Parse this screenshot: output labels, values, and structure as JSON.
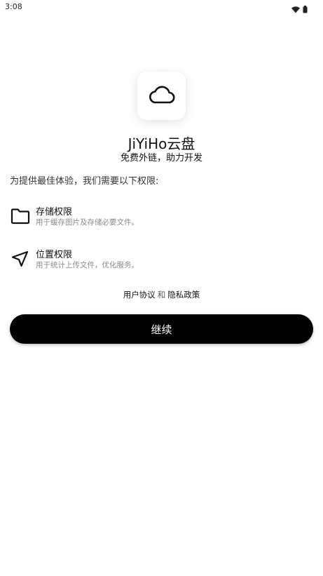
{
  "status_bar": {
    "time": "3:08",
    "icons": [
      "wifi-icon",
      "battery-icon"
    ]
  },
  "app": {
    "icon": "cloud-icon",
    "name": "JiYiHo云盘",
    "tagline": "免费外链，助力开发"
  },
  "intro": "为提供最佳体验，我们需要以下权限:",
  "permissions": [
    {
      "icon": "folder-icon",
      "title": "存储权限",
      "description": "用于缓存图片及存储必要文件。"
    },
    {
      "icon": "location-arrow-icon",
      "title": "位置权限",
      "description": "用于统计上传文件，优化服务。"
    }
  ],
  "agreement": {
    "user_agreement": "用户协议",
    "conjunction": "和",
    "privacy_policy": "隐私政策"
  },
  "continue_label": "继续",
  "colors": {
    "background": "#ffffff",
    "button": "#000000",
    "button_text": "#ffffff",
    "secondary_text": "#8a8a8a"
  }
}
